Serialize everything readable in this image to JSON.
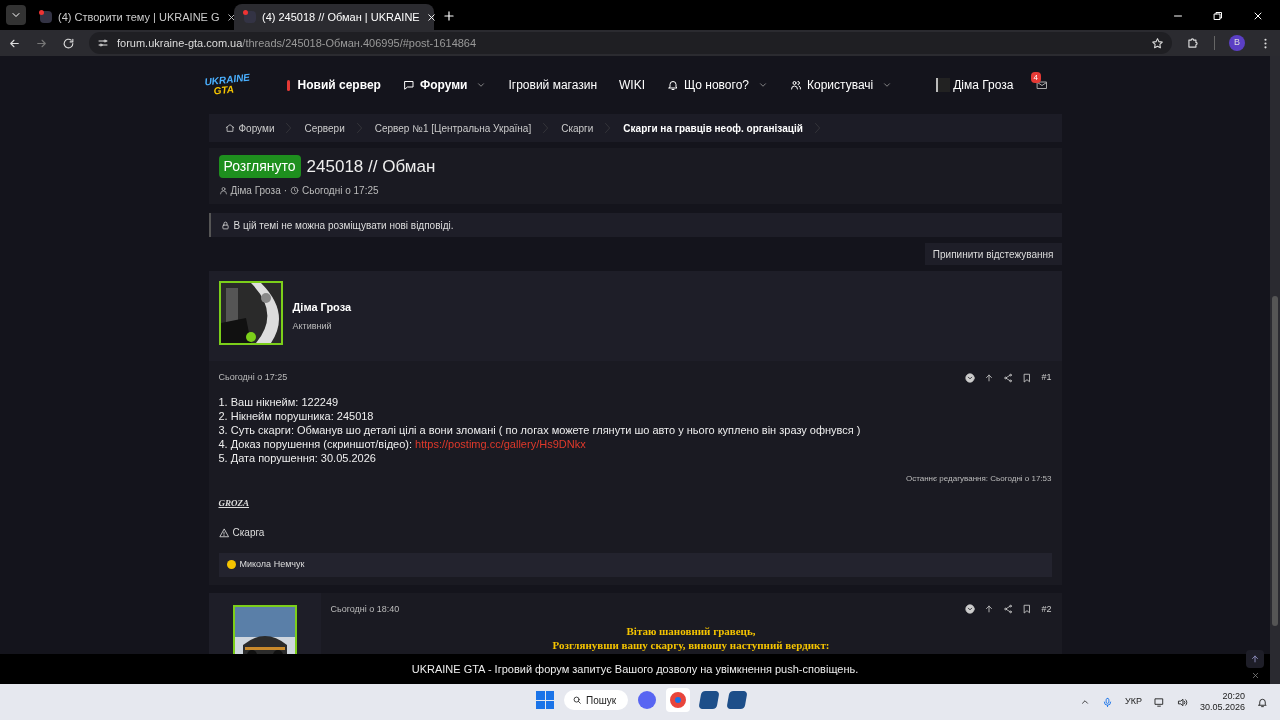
{
  "browser": {
    "tabs": [
      {
        "title": "(4) Створити тему | UKRAINE G",
        "selected": false
      },
      {
        "title": "(4) 245018 // Обман | UKRAINE",
        "selected": true
      }
    ],
    "url": {
      "host": "forum.ukraine-gta.com.ua",
      "path": "/threads/245018-Обман.406995/#post-1614864"
    },
    "profile": "B"
  },
  "header": {
    "logo": [
      "UKRAINE",
      "GTA"
    ],
    "nav": [
      {
        "label": "Новий сервер",
        "kind": "alert",
        "bold": true,
        "dropdown": false
      },
      {
        "label": "Форуми",
        "kind": "chat",
        "bold": true,
        "dropdown": true
      },
      {
        "label": "Ігровий магазин",
        "kind": "plain",
        "bold": false,
        "dropdown": false
      },
      {
        "label": "WIKI",
        "kind": "plain",
        "bold": false,
        "dropdown": false
      },
      {
        "label": "Що нового?",
        "kind": "bell",
        "bold": false,
        "dropdown": true
      },
      {
        "label": "Користувачі",
        "kind": "users",
        "bold": false,
        "dropdown": true
      }
    ],
    "user": "Діма Гроза",
    "inbox_badge": "4"
  },
  "breadcrumbs": [
    {
      "label": "Форуми",
      "current": false
    },
    {
      "label": "Сервери",
      "current": false
    },
    {
      "label": "Сервер №1 [Центральна Україна]",
      "current": false
    },
    {
      "label": "Скарги",
      "current": false
    },
    {
      "label": "Скарги на гравців неоф. організацій",
      "current": true
    }
  ],
  "thread": {
    "prefix": "Розглянуто",
    "title": "245018 // Обман",
    "author": "Діма Гроза",
    "separator": "·",
    "time": "Сьогодні о 17:25"
  },
  "notice": "В цій темі не можна розміщувати нові відповіді.",
  "watch_button": "Припинити відстежування",
  "post1": {
    "author": "Діма Гроза",
    "role": "Активний",
    "time": "Сьогодні о 17:25",
    "number": "#1",
    "lines": [
      {
        "text": "1. Ваш нікнейм: 122249"
      },
      {
        "text": "2. Нікнейм порушника: 245018"
      },
      {
        "text": "3. Суть скарги: Обманув шо деталі цілі а вони зломані ( по логах можете глянути шо авто у нього куплено він зразу офнувся )"
      },
      {
        "text": "4. Доказ порушення (скриншот/відео):",
        "link": "https://postimg.cc/gallery/Hs9DNkx"
      },
      {
        "text": "5. Дата порушення: 30.05.2026"
      }
    ],
    "edited": "Останнє редагування: Сьогодні о 17:53",
    "signature": "GROZA",
    "report": "Скарга",
    "reactions": "Микола Немчук"
  },
  "post2": {
    "time": "Сьогодні о 18:40",
    "number": "#2",
    "lines": [
      "Вітаю шановний гравець,",
      "Розглянувши вашу скаргу, виношу наступний вердикт:"
    ]
  },
  "push_notice": "UKRAINE GTA - Ігровий форум запитує Вашого дозволу на увімкнення push-сповіщень.",
  "taskbar": {
    "search": "Пошук",
    "language": "УКР",
    "time": "20:20",
    "date": "30.05.2026"
  }
}
